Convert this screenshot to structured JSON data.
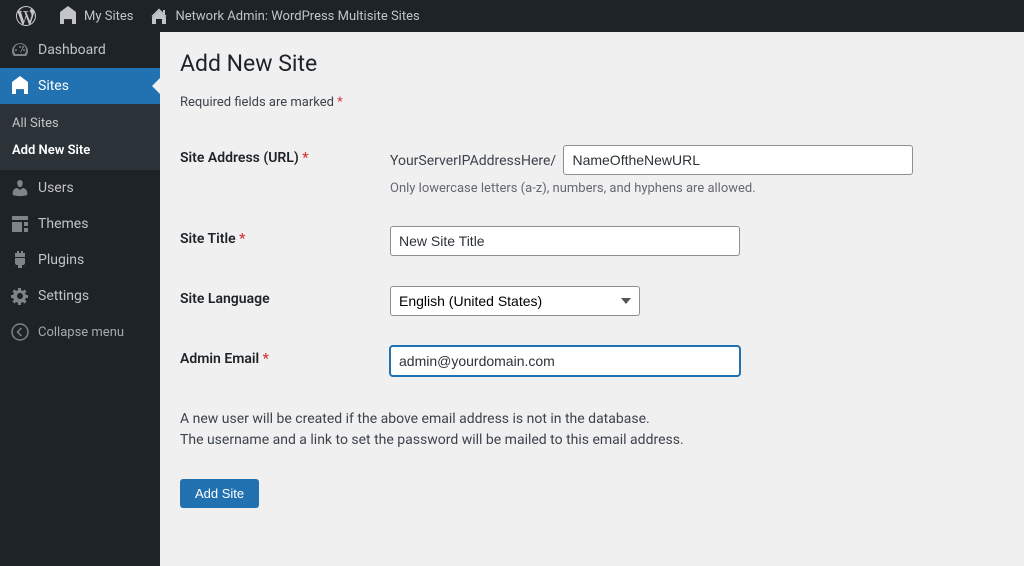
{
  "topbar": {
    "mysites": "My Sites",
    "network_admin": "Network Admin: WordPress Multisite Sites"
  },
  "sidebar": {
    "dashboard": "Dashboard",
    "sites": "Sites",
    "all_sites": "All Sites",
    "add_new_site": "Add New Site",
    "users": "Users",
    "themes": "Themes",
    "plugins": "Plugins",
    "settings": "Settings",
    "collapse": "Collapse menu"
  },
  "page": {
    "title": "Add New Site",
    "required_note": "Required fields are marked ",
    "required_mark": "*"
  },
  "form": {
    "site_address": {
      "label": "Site Address (URL) ",
      "prefix": "YourServerIPAddressHere/",
      "value": "NameOftheNewURL",
      "help": "Only lowercase letters (a-z), numbers, and hyphens are allowed."
    },
    "site_title": {
      "label": "Site Title ",
      "value": "New Site Title"
    },
    "site_language": {
      "label": "Site Language",
      "selected": "English (United States)"
    },
    "admin_email": {
      "label": "Admin Email ",
      "value": "admin@yourdomain.com"
    },
    "info_line1": "A new user will be created if the above email address is not in the database.",
    "info_line2": "The username and a link to set the password will be mailed to this email address.",
    "submit": "Add Site"
  }
}
